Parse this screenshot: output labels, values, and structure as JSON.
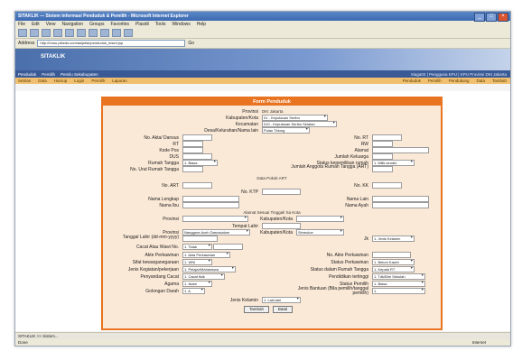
{
  "window": {
    "title": "SITAKLIK — Sistem Informasi Penduduk & Pemilih - Microsoft Internet Explorer"
  },
  "menu": [
    "File",
    "Edit",
    "View",
    "Navigation",
    "Groups",
    "Favorites",
    "Plasidi",
    "Tools",
    "Windows",
    "Help"
  ],
  "address": {
    "label": "Address",
    "url": "http://hnnu.pibeds.com/asijnfsk/penduduk_insert.jsp",
    "go": "Go"
  },
  "banner": {
    "logo": "SITAKLIK"
  },
  "nav1": {
    "left": [
      "Penduduk",
      "Pemilih",
      "Pemilu Sekabupaten"
    ],
    "right": "Siaga02 | Pengguna KPU | KPU Provinsi DKI Jakarta"
  },
  "nav2": {
    "left": [
      "Setrian",
      "Data",
      "Hasrup",
      "Login",
      "Pemilih",
      "Laporan"
    ],
    "right": [
      "Penduduk",
      "Pemilih",
      "Pendukung",
      "Data",
      "Tambah"
    ]
  },
  "form": {
    "title": "Form Penduduk",
    "provinsi": {
      "label": "Provinsi",
      "value": "DKI Jakarta"
    },
    "kab": {
      "label": "Kabupaten/Kota",
      "value": "01 - Kepulauan Seribu"
    },
    "kec": {
      "label": "Kecamatan",
      "value": "010 - Kepulauan Seribu Selatan"
    },
    "desa": {
      "label": "Desa/Kelurahan/Nama lain",
      "value": "Pulau Tidung"
    },
    "no_akta": {
      "label": "No. Akta/ Dansus"
    },
    "no_rt": {
      "label": "No. RT"
    },
    "rt": {
      "label": "RT"
    },
    "rw": {
      "label": "RW"
    },
    "kode_pos": {
      "label": "Kode Pos"
    },
    "alamat": {
      "label": "Alamat"
    },
    "dus": {
      "label": "DUS"
    },
    "jumlah_keluarga": {
      "label": "Jumlah Keluarga"
    },
    "rumah_tangga": {
      "label": "Rumah Tangga",
      "value": "1. Biasa"
    },
    "status_kepemilikan": {
      "label": "Status kepemilikan rumah",
      "value": "1. Milik sendiri"
    },
    "no_urut": {
      "label": "No. Urut Rumah Tangga"
    },
    "jumlah_anggota": {
      "label": "Jumlah Anggota Rumah Tangga (ART)"
    },
    "data_pokok": {
      "label": "Data Pokok ART"
    },
    "no_art": {
      "label": "No. ART"
    },
    "no_kk": {
      "label": "No. KK"
    },
    "no_ktp": {
      "label": "No. KTP"
    },
    "nama_lengkap": {
      "label": "Nama Lengkap"
    },
    "nama_lain": {
      "label": "Nama Lain"
    },
    "nama_ibu": {
      "label": "Nama Ibu"
    },
    "nama_ayah": {
      "label": "Nama Ayah"
    },
    "alamat_sesuai": {
      "label": "Alamat Sesuai Tinggal/ Sa Kota"
    },
    "provinsi2": {
      "label": "Provinsi"
    },
    "kab2": {
      "label": "Kabupaten/Kota"
    },
    "tempat_lahir": {
      "label": "Tempat Lahir"
    },
    "provinsi3": {
      "label": "Provinsi",
      "value": "Nanggroe Aceh Darussalam"
    },
    "kab3": {
      "label": "Kabupaten/Kota",
      "value": "Simeulue"
    },
    "tgl_lahir": {
      "label": "Tanggal Lahir (dd-mm-yyyy)"
    },
    "jk": {
      "label": "Jk",
      "value": "1. Jenis Kelamin"
    },
    "cacat": {
      "label": "Cacat Atau Wawi No.",
      "value": "1. Tidak"
    },
    "akte_perkawinan": {
      "label": "Akte Perkawinan",
      "value": "1. Akta Perkawinan"
    },
    "no_akte_perkawinan": {
      "label": "No. Akte Perkawinan"
    },
    "sifat_kewarganegaraan": {
      "label": "Sifat kewarganegaraan",
      "value": "1. WNI"
    },
    "status_perkawinan": {
      "label": "Status Perkawinan",
      "value": "1. Belum Kawin"
    },
    "jenis_kegiatan": {
      "label": "Jenis Kegiatan/pekerjaan",
      "value": "1. Pelajar/Mahasiswa"
    },
    "status_dalam_rt": {
      "label": "Status dalam Rumah Tangga",
      "value": "1. Kepala RT"
    },
    "penyandang_cacat": {
      "label": "Penyandang Cacat",
      "value": "1. Cacat fisik"
    },
    "pendidikan": {
      "label": "Pendidikan tertinggi",
      "value": "1. Tdk/Blm Sekolah"
    },
    "agama": {
      "label": "Agama",
      "value": "1. Islam"
    },
    "status_pemilih": {
      "label": "Status Pemilih",
      "value": "1. Biasa"
    },
    "gol_darah": {
      "label": "Golongan Darah",
      "value": "1. A"
    },
    "jenis_bantuan": {
      "label": "Jenis Bantuan (Bila pemilih/tanggal pemilih)",
      "value": "1."
    },
    "jenis_kelamin": {
      "label": "Jenis Kelamin",
      "value": "1. Laki-laki"
    },
    "btn_tambah": "Tambah",
    "btn_batal": "Batal"
  },
  "taskbar": {
    "item": "SITAKLIK >> Sistem..."
  },
  "status": {
    "left": "Done",
    "zone": "Internet"
  }
}
